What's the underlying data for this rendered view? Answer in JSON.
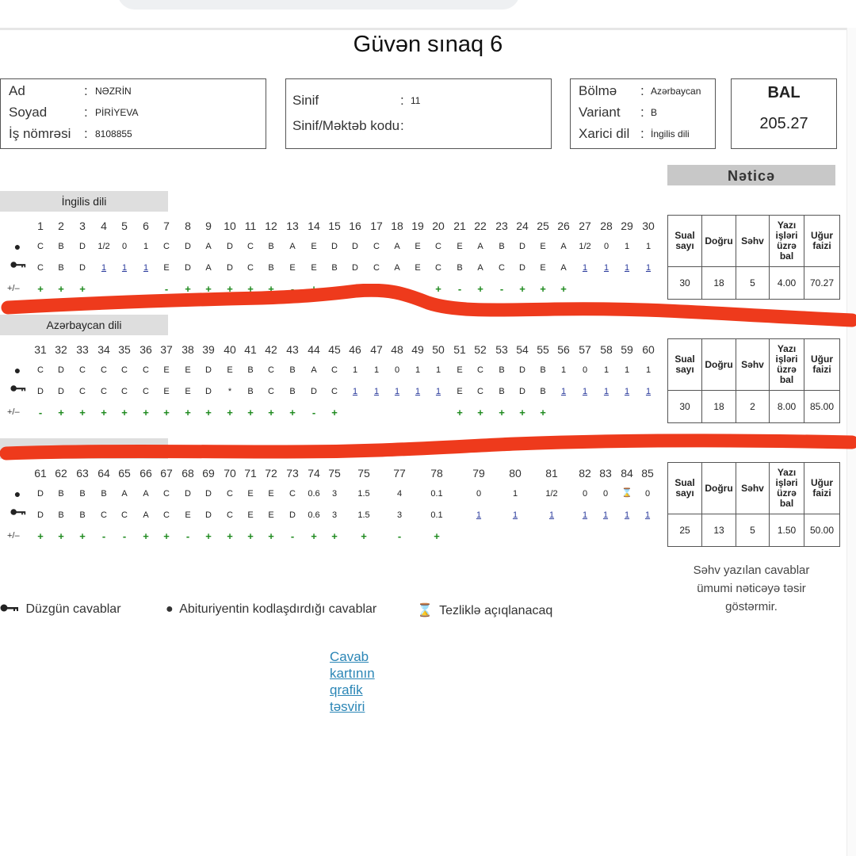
{
  "page": {
    "title": "Güvən sınaq 6"
  },
  "student": {
    "ad_label": "Ad",
    "ad_value": "NƏZRİN",
    "soyad_label": "Soyad",
    "soyad_value": "PİRİYEVA",
    "is_label": "İş nömrəsi",
    "is_value": "8108855"
  },
  "school": {
    "sinif_label": "Sinif",
    "sinif_value": "11",
    "kod_label": "Sinif/Məktəb kodu",
    "kod_value": ""
  },
  "section_info": {
    "bolme_label": "Bölmə",
    "bolme_value": "Azərbaycan",
    "variant_label": "Variant",
    "variant_value": "B",
    "xarici_label": "Xarici dil",
    "xarici_value": "İngilis dili"
  },
  "score": {
    "label": "BAL",
    "value": "205.27"
  },
  "result_header": "Nəticə",
  "colon": ":",
  "row_labels": {
    "plusminus": "+/–"
  },
  "result_headers": [
    "Sual sayı",
    "Doğru",
    "Səhv",
    "Yazı işləri üzrə bal",
    "Uğur faizi"
  ],
  "sections": [
    {
      "label": "İngilis dili",
      "questions": [
        {
          "n": "1",
          "a": "C",
          "k": "C",
          "m": "+"
        },
        {
          "n": "2",
          "a": "B",
          "k": "B",
          "m": "+"
        },
        {
          "n": "3",
          "a": "D",
          "k": "D",
          "m": "+"
        },
        {
          "n": "4",
          "a": "1/2",
          "k": "1",
          "m": ""
        },
        {
          "n": "5",
          "a": "0",
          "k": "1",
          "m": ""
        },
        {
          "n": "6",
          "a": "1",
          "k": "1",
          "m": ""
        },
        {
          "n": "7",
          "a": "C",
          "k": "E",
          "m": "-"
        },
        {
          "n": "8",
          "a": "D",
          "k": "D",
          "m": "+"
        },
        {
          "n": "9",
          "a": "A",
          "k": "A",
          "m": "+"
        },
        {
          "n": "10",
          "a": "D",
          "k": "D",
          "m": "+"
        },
        {
          "n": "11",
          "a": "C",
          "k": "C",
          "m": "+"
        },
        {
          "n": "12",
          "a": "B",
          "k": "B",
          "m": "+"
        },
        {
          "n": "13",
          "a": "A",
          "k": "E",
          "m": "-"
        },
        {
          "n": "14",
          "a": "E",
          "k": "E",
          "m": "+"
        },
        {
          "n": "15",
          "a": "D",
          "k": "B",
          "m": "-"
        },
        {
          "n": "16",
          "a": "D",
          "k": "D",
          "m": ""
        },
        {
          "n": "17",
          "a": "C",
          "k": "C",
          "m": ""
        },
        {
          "n": "18",
          "a": "A",
          "k": "A",
          "m": ""
        },
        {
          "n": "19",
          "a": "E",
          "k": "E",
          "m": ""
        },
        {
          "n": "20",
          "a": "C",
          "k": "C",
          "m": "+"
        },
        {
          "n": "21",
          "a": "E",
          "k": "B",
          "m": "-"
        },
        {
          "n": "22",
          "a": "A",
          "k": "A",
          "m": "+"
        },
        {
          "n": "23",
          "a": "B",
          "k": "C",
          "m": "-"
        },
        {
          "n": "24",
          "a": "D",
          "k": "D",
          "m": "+"
        },
        {
          "n": "25",
          "a": "E",
          "k": "E",
          "m": "+"
        },
        {
          "n": "26",
          "a": "A",
          "k": "A",
          "m": "+"
        },
        {
          "n": "27",
          "a": "1/2",
          "k": "1",
          "m": ""
        },
        {
          "n": "28",
          "a": "0",
          "k": "1",
          "m": ""
        },
        {
          "n": "29",
          "a": "1",
          "k": "1",
          "m": ""
        },
        {
          "n": "30",
          "a": "1",
          "k": "1",
          "m": ""
        }
      ],
      "results": {
        "sual": "30",
        "dogru": "18",
        "sehv": "5",
        "bal": "4.00",
        "ugur": "70.27"
      }
    },
    {
      "label": "Azərbaycan dili",
      "questions": [
        {
          "n": "31",
          "a": "C",
          "k": "D",
          "m": "-"
        },
        {
          "n": "32",
          "a": "D",
          "k": "D",
          "m": "+"
        },
        {
          "n": "33",
          "a": "C",
          "k": "C",
          "m": "+"
        },
        {
          "n": "34",
          "a": "C",
          "k": "C",
          "m": "+"
        },
        {
          "n": "35",
          "a": "C",
          "k": "C",
          "m": "+"
        },
        {
          "n": "36",
          "a": "C",
          "k": "C",
          "m": "+"
        },
        {
          "n": "37",
          "a": "E",
          "k": "E",
          "m": "+"
        },
        {
          "n": "38",
          "a": "E",
          "k": "E",
          "m": "+"
        },
        {
          "n": "39",
          "a": "D",
          "k": "D",
          "m": "+"
        },
        {
          "n": "40",
          "a": "E",
          "k": "*",
          "m": "+"
        },
        {
          "n": "41",
          "a": "B",
          "k": "B",
          "m": "+"
        },
        {
          "n": "42",
          "a": "C",
          "k": "C",
          "m": "+"
        },
        {
          "n": "43",
          "a": "B",
          "k": "B",
          "m": "+"
        },
        {
          "n": "44",
          "a": "A",
          "k": "D",
          "m": "-"
        },
        {
          "n": "45",
          "a": "C",
          "k": "C",
          "m": "+"
        },
        {
          "n": "46",
          "a": "1",
          "k": "1",
          "m": ""
        },
        {
          "n": "47",
          "a": "1",
          "k": "1",
          "m": ""
        },
        {
          "n": "48",
          "a": "0",
          "k": "1",
          "m": ""
        },
        {
          "n": "49",
          "a": "1",
          "k": "1",
          "m": ""
        },
        {
          "n": "50",
          "a": "1",
          "k": "1",
          "m": ""
        },
        {
          "n": "51",
          "a": "E",
          "k": "E",
          "m": "+"
        },
        {
          "n": "52",
          "a": "C",
          "k": "C",
          "m": "+"
        },
        {
          "n": "53",
          "a": "B",
          "k": "B",
          "m": "+"
        },
        {
          "n": "54",
          "a": "D",
          "k": "D",
          "m": "+"
        },
        {
          "n": "55",
          "a": "B",
          "k": "B",
          "m": "+"
        },
        {
          "n": "56",
          "a": "1",
          "k": "1",
          "m": ""
        },
        {
          "n": "57",
          "a": "0",
          "k": "1",
          "m": ""
        },
        {
          "n": "58",
          "a": "1",
          "k": "1",
          "m": ""
        },
        {
          "n": "59",
          "a": "1",
          "k": "1",
          "m": ""
        },
        {
          "n": "60",
          "a": "1",
          "k": "1",
          "m": ""
        }
      ],
      "results": {
        "sual": "30",
        "dogru": "18",
        "sehv": "2",
        "bal": "8.00",
        "ugur": "85.00"
      }
    },
    {
      "label": "",
      "questions": [
        {
          "n": "61",
          "a": "D",
          "k": "D",
          "m": "+"
        },
        {
          "n": "62",
          "a": "B",
          "k": "B",
          "m": "+"
        },
        {
          "n": "63",
          "a": "B",
          "k": "B",
          "m": "+"
        },
        {
          "n": "64",
          "a": "B",
          "k": "C",
          "m": "-"
        },
        {
          "n": "65",
          "a": "A",
          "k": "C",
          "m": "-"
        },
        {
          "n": "66",
          "a": "A",
          "k": "A",
          "m": "+"
        },
        {
          "n": "67",
          "a": "C",
          "k": "C",
          "m": "+"
        },
        {
          "n": "68",
          "a": "D",
          "k": "E",
          "m": "-"
        },
        {
          "n": "69",
          "a": "D",
          "k": "D",
          "m": "+"
        },
        {
          "n": "70",
          "a": "C",
          "k": "C",
          "m": "+"
        },
        {
          "n": "71",
          "a": "E",
          "k": "E",
          "m": "+"
        },
        {
          "n": "72",
          "a": "E",
          "k": "E",
          "m": "+"
        },
        {
          "n": "73",
          "a": "C",
          "k": "D",
          "m": "-"
        },
        {
          "n": "74",
          "a": "0.6",
          "k": "0.6",
          "m": "+"
        },
        {
          "n": "75",
          "a": "3",
          "k": "3",
          "m": "+"
        },
        {
          "n": "75",
          "a": "1.5",
          "k": "1.5",
          "m": "+"
        },
        {
          "n": "77",
          "a": "4",
          "k": "3",
          "m": "-"
        },
        {
          "n": "78",
          "a": "0.1",
          "k": "0.1",
          "m": "+"
        },
        {
          "n": "79",
          "a": "0",
          "k": "1",
          "m": ""
        },
        {
          "n": "80",
          "a": "1",
          "k": "1",
          "m": ""
        },
        {
          "n": "81",
          "a": "1/2",
          "k": "1",
          "m": ""
        },
        {
          "n": "82",
          "a": "0",
          "k": "1",
          "m": ""
        },
        {
          "n": "83",
          "a": "0",
          "k": "1",
          "m": ""
        },
        {
          "n": "84",
          "a": "",
          "k": "1",
          "m": ""
        },
        {
          "n": "85",
          "a": "0",
          "k": "1",
          "m": ""
        }
      ],
      "results": {
        "sual": "25",
        "dogru": "13",
        "sehv": "5",
        "bal": "1.50",
        "ugur": "50.00"
      }
    }
  ],
  "note": "Səhv yazılan cavablar ümumi nəticəyə təsir göstərmir.",
  "legend": {
    "key_text": "Düzgün cavablar",
    "dot_text": "Abituriyentin kodlaşdırdığı cavablar",
    "hour_text": "Tezliklə açıqlanacaq"
  },
  "link_text": "Cavab kartının qrafik təsviri",
  "icons": {
    "key": "key-icon",
    "dot": "dot-icon",
    "hourglass": "hourglass-icon"
  },
  "colors": {
    "plus": "#1e8a1e",
    "underline_link": "#2a3a9c",
    "annotation": "#ee3a1c",
    "header_bg": "#c8c8c8"
  }
}
